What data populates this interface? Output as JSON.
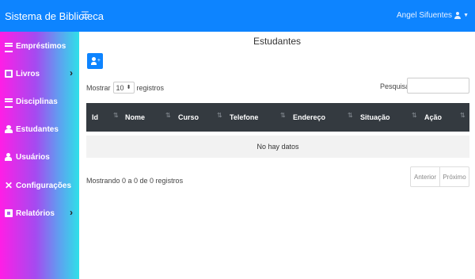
{
  "header": {
    "brand": "Sistema de Biblioteca",
    "menu_icon": "☰",
    "user_name": "Angel Sifuentes",
    "caret": "▼"
  },
  "sidebar": {
    "items": [
      {
        "label": "Empréstimos",
        "icon": "list-icon",
        "has_submenu": false
      },
      {
        "label": "Livros",
        "icon": "book-icon",
        "has_submenu": true
      },
      {
        "label": "Disciplinas",
        "icon": "list-icon",
        "has_submenu": false
      },
      {
        "label": "Estudantes",
        "icon": "graduate-icon",
        "has_submenu": false
      },
      {
        "label": "Usuários",
        "icon": "user-icon",
        "has_submenu": false
      },
      {
        "label": "Configurações",
        "icon": "tools-icon",
        "has_submenu": false
      },
      {
        "label": "Relatórios",
        "icon": "report-icon",
        "has_submenu": true
      }
    ],
    "submenu_arrow": "›"
  },
  "main": {
    "title": "Estudantes",
    "add_button_plus": "+",
    "length": {
      "prefix": "Mostrar",
      "value": "10",
      "suffix": "registros",
      "caret": "⬍"
    },
    "search_label": "Pesquisar:",
    "search_value": "",
    "table": {
      "columns": [
        "Id",
        "Nome",
        "Curso",
        "Telefone",
        "Endereço",
        "Situação",
        "Ação"
      ],
      "sort_glyph": "⇅",
      "empty_text": "No hay datos"
    },
    "info": "Mostrando 0 a 0 de 0 registros",
    "pagination": {
      "prev": "Anterior",
      "next": "Próximo"
    }
  },
  "colors": {
    "topbar": "#0d84ff",
    "table_header": "#343a40",
    "sidebar_start": "#ff1ee6",
    "sidebar_end": "#2fe0e8"
  }
}
